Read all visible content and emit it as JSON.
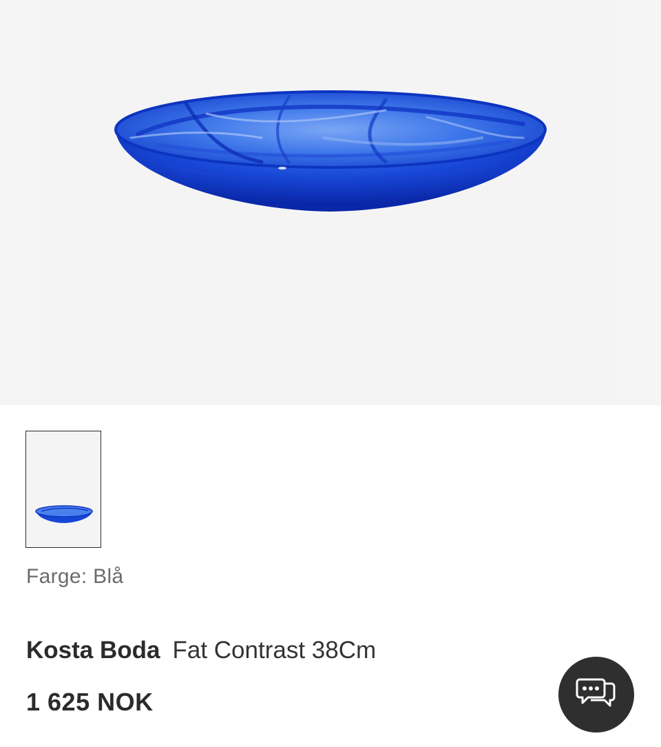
{
  "product": {
    "image_alt": "Kosta Boda Fat Contrast 38Cm",
    "color_label": "Farge: Blå",
    "brand": "Kosta Boda",
    "name": "Fat Contrast 38Cm",
    "price": "1 625 NOK"
  },
  "colors": {
    "bowl_dark": "#0a2fb8",
    "bowl_mid": "#1f55e0",
    "bowl_light": "#6d9af0",
    "chat_bg": "#2f2f2f"
  },
  "icons": {
    "chat": "chat-bubbles-icon"
  }
}
